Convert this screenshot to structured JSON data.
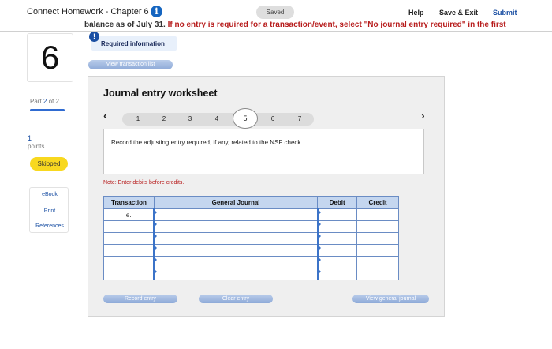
{
  "header": {
    "title": "Connect Homework - Chapter 6",
    "saved_label": "Saved",
    "help_label": "Help",
    "save_exit_label": "Save & Exit",
    "submit_label": "Submit"
  },
  "banner": {
    "gray_text": "balance as of July 31.",
    "red_text": " If no entry is required for a transaction/event, select \"No journal entry required\" in the first"
  },
  "sidebar": {
    "question_number": "6",
    "part_prefix": "Part",
    "part_current": "2",
    "part_of": "of 2",
    "points_value": "1",
    "points_label": "points",
    "status_badge": "Skipped",
    "resources": [
      "eBook",
      "Print",
      "References"
    ]
  },
  "required_info": {
    "label": "Required information",
    "alert_glyph": "!"
  },
  "view_transaction_label": "View transaction list",
  "worksheet": {
    "title": "Journal entry worksheet",
    "pages": [
      "1",
      "2",
      "3",
      "4",
      "5",
      "6",
      "7"
    ],
    "active_page": "5",
    "instruction": "Record the adjusting entry required, if any, related to the NSF check.",
    "note": "Note: Enter debits before credits.",
    "table": {
      "headers": [
        "Transaction",
        "General Journal",
        "Debit",
        "Credit"
      ],
      "rows": [
        {
          "transaction": "e.",
          "general_journal": "",
          "debit": "",
          "credit": ""
        },
        {
          "transaction": "",
          "general_journal": "",
          "debit": "",
          "credit": ""
        },
        {
          "transaction": "",
          "general_journal": "",
          "debit": "",
          "credit": ""
        },
        {
          "transaction": "",
          "general_journal": "",
          "debit": "",
          "credit": ""
        },
        {
          "transaction": "",
          "general_journal": "",
          "debit": "",
          "credit": ""
        },
        {
          "transaction": "",
          "general_journal": "",
          "debit": "",
          "credit": ""
        }
      ]
    },
    "record_entry_label": "Record entry",
    "clear_entry_label": "Clear entry",
    "view_general_journal_label": "View general journal"
  },
  "colors": {
    "accent_blue": "#1a4fa3",
    "table_header": "#c4d6ef",
    "table_border": "#6a8cc4",
    "skipped_yellow": "#f8d81f",
    "note_red": "#b71c1c"
  }
}
